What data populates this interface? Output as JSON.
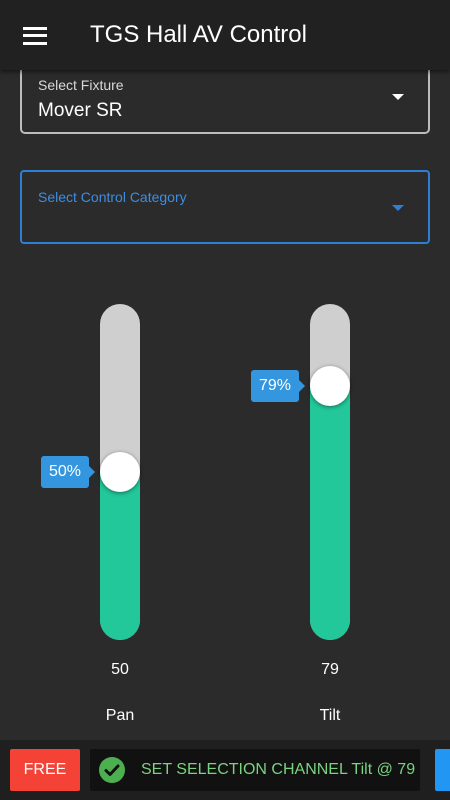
{
  "app": {
    "title": "TGS Hall AV Control",
    "menu_icon": "hamburger-menu-icon"
  },
  "fixture_select": {
    "label": "Select Fixture",
    "value": "Mover SR"
  },
  "category_select": {
    "label": "Select Control Category",
    "value": ""
  },
  "sliders": [
    {
      "name": "Pan",
      "value": "50",
      "percent": 50,
      "tooltip": "50%"
    },
    {
      "name": "Tilt",
      "value": "79",
      "percent": 79,
      "tooltip": "79%"
    }
  ],
  "bottom_bar": {
    "free_label": "FREE",
    "status_icon": "check-circle-icon",
    "status_text": "SET SELECTION CHANNEL Tilt @ 79"
  },
  "colors": {
    "accent": "#2d7fd3",
    "slider_fill": "#22c79a",
    "tooltip": "#3596e0",
    "free_button": "#f44336",
    "status_text": "#7bd27f"
  }
}
